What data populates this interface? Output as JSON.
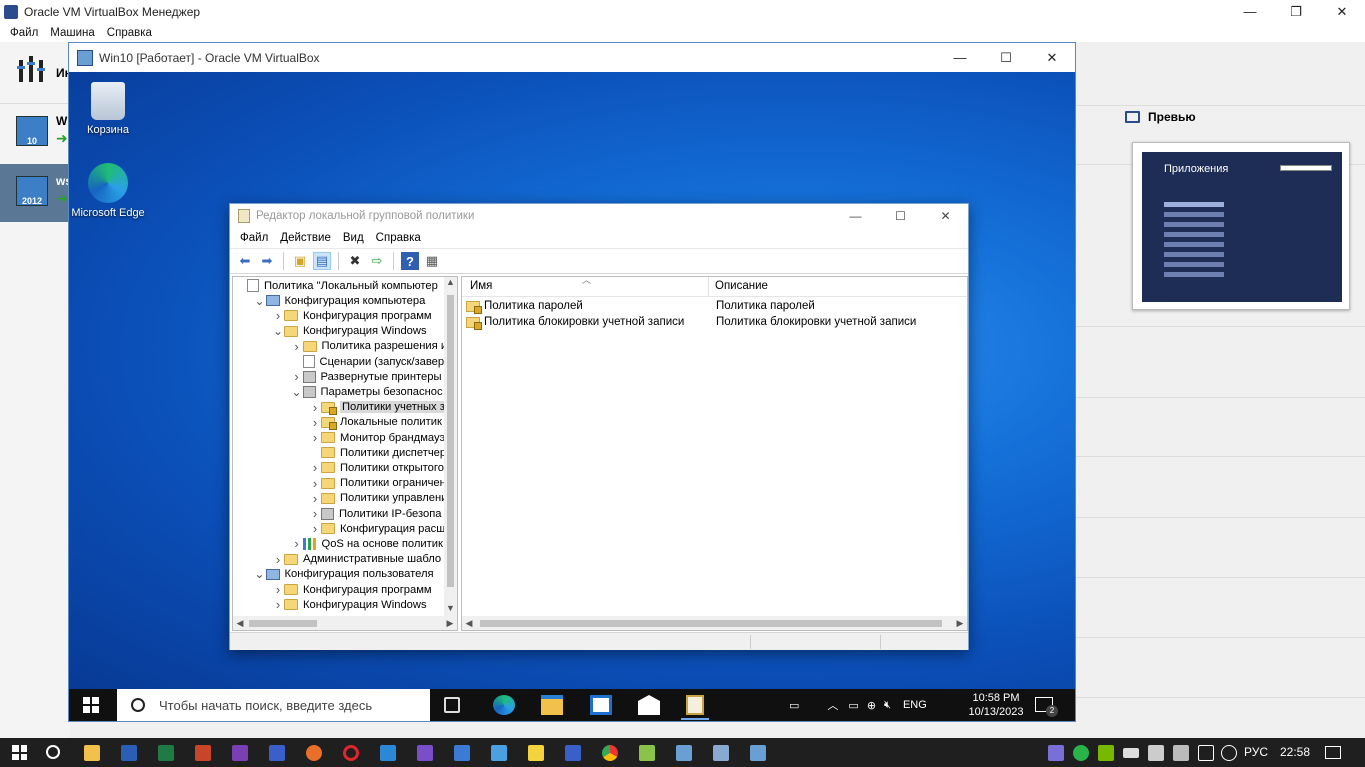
{
  "host": {
    "title": "Oracle VM VirtualBox Менеджер",
    "menu": [
      "Файл",
      "Машина",
      "Справка"
    ],
    "tools_label": "Ин",
    "vms": [
      {
        "name": "Wi",
        "os_badge": "10"
      },
      {
        "name": "ws",
        "os_badge": "2012"
      }
    ],
    "preview": {
      "title": "Превью",
      "screen_title": "Приложения"
    }
  },
  "vm": {
    "title": "Win10 [Работает] - Oracle VM VirtualBox",
    "desktop_icons": [
      {
        "label": "Корзина"
      },
      {
        "label": "Microsoft Edge"
      }
    ],
    "taskbar": {
      "search_placeholder": "Чтобы начать поиск, введите здесь",
      "lang": "ENG",
      "time": "10:58 PM",
      "date": "10/13/2023",
      "notif_count": "2"
    }
  },
  "gpedit": {
    "title": "Редактор локальной групповой политики",
    "menu": [
      "Файл",
      "Действие",
      "Вид",
      "Справка"
    ],
    "tree": [
      {
        "label": "Политика \"Локальный компьютер",
        "indent": 0,
        "exp": "",
        "icon": "doc"
      },
      {
        "label": "Конфигурация компьютера",
        "indent": 1,
        "exp": "v",
        "icon": "comp"
      },
      {
        "label": "Конфигурация программ",
        "indent": 2,
        "exp": ">",
        "icon": "folder"
      },
      {
        "label": "Конфигурация Windows",
        "indent": 2,
        "exp": "v",
        "icon": "folder"
      },
      {
        "label": "Политика разрешения и",
        "indent": 3,
        "exp": ">",
        "icon": "folder"
      },
      {
        "label": "Сценарии (запуск/завер",
        "indent": 3,
        "exp": "",
        "icon": "doc"
      },
      {
        "label": "Развернутые принтеры",
        "indent": 3,
        "exp": ">",
        "icon": "gear"
      },
      {
        "label": "Параметры безопаснос",
        "indent": 3,
        "exp": "v",
        "icon": "gear"
      },
      {
        "label": "Политики учетных з",
        "indent": 4,
        "exp": ">",
        "icon": "lockfolder",
        "selected": true
      },
      {
        "label": "Локальные политик",
        "indent": 4,
        "exp": ">",
        "icon": "lockfolder"
      },
      {
        "label": "Монитор брандмауэ",
        "indent": 4,
        "exp": ">",
        "icon": "folder"
      },
      {
        "label": "Политики диспетчер",
        "indent": 4,
        "exp": "",
        "icon": "folder"
      },
      {
        "label": "Политики открытого",
        "indent": 4,
        "exp": ">",
        "icon": "folder"
      },
      {
        "label": "Политики ограничен",
        "indent": 4,
        "exp": ">",
        "icon": "folder"
      },
      {
        "label": "Политики управлени",
        "indent": 4,
        "exp": ">",
        "icon": "folder"
      },
      {
        "label": "Политики IP-безопа",
        "indent": 4,
        "exp": ">",
        "icon": "gear"
      },
      {
        "label": "Конфигурация расш",
        "indent": 4,
        "exp": ">",
        "icon": "folder"
      },
      {
        "label": "QoS на основе политик",
        "indent": 3,
        "exp": ">",
        "icon": "bars"
      },
      {
        "label": "Административные шабло",
        "indent": 2,
        "exp": ">",
        "icon": "folder"
      },
      {
        "label": "Конфигурация пользователя",
        "indent": 1,
        "exp": "v",
        "icon": "comp"
      },
      {
        "label": "Конфигурация программ",
        "indent": 2,
        "exp": ">",
        "icon": "folder"
      },
      {
        "label": "Конфигурация Windows",
        "indent": 2,
        "exp": ">",
        "icon": "folder"
      }
    ],
    "columns": [
      "Имя",
      "Описание"
    ],
    "rows": [
      {
        "name": "Политика паролей",
        "desc": "Политика паролей"
      },
      {
        "name": "Политика блокировки учетной записи",
        "desc": "Политика блокировки учетной записи"
      }
    ]
  },
  "host_taskbar": {
    "lang": "РУС",
    "time": "22:58"
  },
  "colors": {
    "vm_selected": "#5a7796",
    "desktop": "#0b5bd0",
    "accent": "#3a6fc0"
  }
}
